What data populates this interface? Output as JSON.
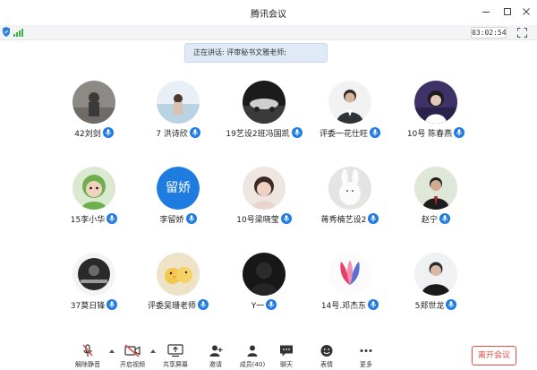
{
  "window": {
    "title": "腾讯会议"
  },
  "status": {
    "timer": "03:02:54"
  },
  "banner": {
    "speaking": "正在讲话: 评审秘书文雅老师;"
  },
  "participants": [
    {
      "name": "42刘剑",
      "avatar": "photo"
    },
    {
      "name": "7 洪诗欣",
      "avatar": "photo"
    },
    {
      "name": "19艺设2班冯国凯",
      "avatar": "photo"
    },
    {
      "name": "评委一花仕旺",
      "avatar": "photo"
    },
    {
      "name": "10号 陈春燕",
      "avatar": "photo"
    },
    {
      "name": "15李小华",
      "avatar": "photo"
    },
    {
      "name": "李留娇",
      "avatar": "text",
      "avatar_text": "留娇"
    },
    {
      "name": "10号梁晓莹",
      "avatar": "photo"
    },
    {
      "name": "蒋秀楠艺设2",
      "avatar": "photo"
    },
    {
      "name": "赵宁",
      "avatar": "photo"
    },
    {
      "name": "37莫日锋",
      "avatar": "photo"
    },
    {
      "name": "评委吴珊老师",
      "avatar": "photo"
    },
    {
      "name": "Y一",
      "avatar": "photo"
    },
    {
      "name": "14号.邓杰东",
      "avatar": "photo"
    },
    {
      "name": "5郑世龙",
      "avatar": "photo"
    }
  ],
  "toolbar": {
    "mute": "解除静音",
    "video": "开启视频",
    "share": "共享屏幕",
    "invite": "邀请",
    "members": "成员(40)",
    "chat": "聊天",
    "emoji": "表情",
    "more": "更多",
    "leave": "离开会议"
  },
  "colors": {
    "accent": "#1e7be0",
    "leave": "#e34b4b",
    "mic_off": "#e34b4b"
  }
}
